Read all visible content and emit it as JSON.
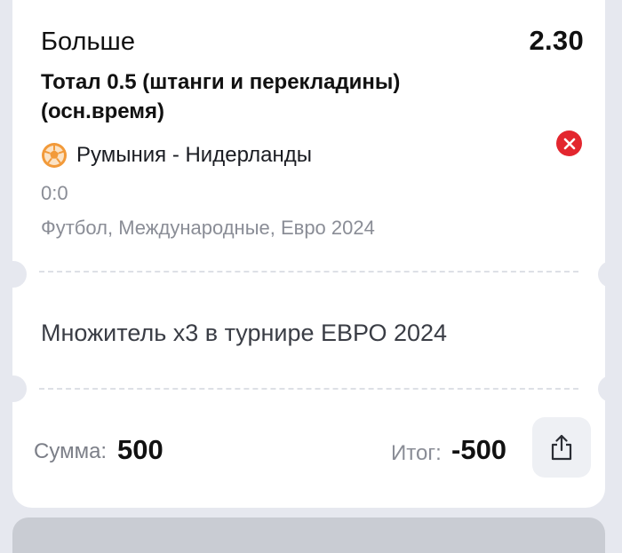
{
  "bet": {
    "outcome": "Больше",
    "odds": "2.30",
    "market": "Тотал 0.5 (штанги и перекладины) (осн.время)",
    "match": "Румыния - Нидерланды",
    "score": "0:0",
    "league": "Футбол, Международные, Евро 2024"
  },
  "promo": {
    "text": "Множитель x3 в турнире ЕВРО 2024"
  },
  "footer": {
    "sum_label": "Сумма:",
    "sum_value": "500",
    "total_label": "Итог:",
    "total_value": "-500"
  },
  "icons": {
    "sport": "football-icon",
    "remove": "close-icon",
    "share": "share-icon"
  },
  "colors": {
    "remove_red": "#e3262e",
    "ball_orange": "#f29a3a",
    "background": "#e6e8ef",
    "muted_text": "#8a8d96"
  }
}
